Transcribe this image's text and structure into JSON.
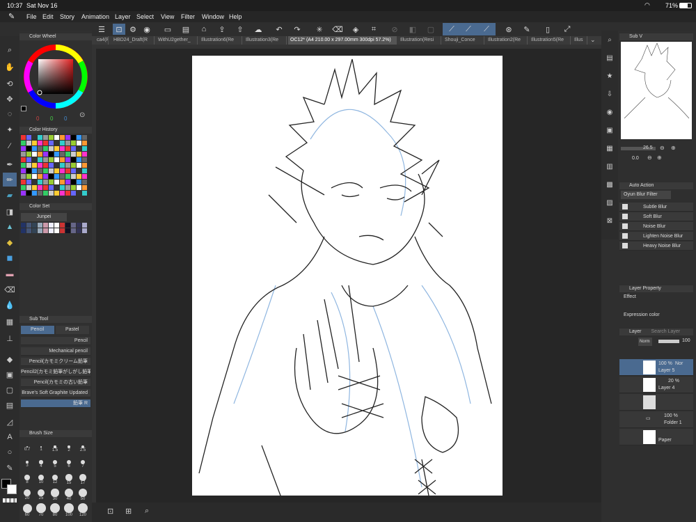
{
  "status": {
    "time": "10:37",
    "date": "Sat Nov 16",
    "battery": "71%"
  },
  "menu": [
    "File",
    "Edit",
    "Story",
    "Animation",
    "Layer",
    "Select",
    "View",
    "Filter",
    "Window",
    "Help"
  ],
  "tabs": [
    "ca4(Re",
    "HBD24_Draft(R",
    "WithU2gether_",
    "Illustration6(Re",
    "Illustration3(Re",
    "OC12* (A4 210.00 x 297.00mm 300dpi 57.2%)",
    "Illustration(Resi",
    "Shouji_Conce",
    "Illustration2(Re",
    "Illustration5(Re",
    "Illus"
  ],
  "left": {
    "color_wheel_title": "Color Wheel",
    "color_values": [
      "0",
      "0",
      "0"
    ],
    "color_history_title": "Color History",
    "color_set_title": "Color Set",
    "color_set_name": "Junpei",
    "sub_tool_title": "Sub Tool",
    "sub_tool_tabs": [
      "Pencil",
      "Pastel"
    ],
    "sub_tools": [
      "Pencil",
      "Mechanical pencil",
      "Pencil(カモミクリーム鉛筆",
      "Pencil2(カモミ鉛筆がしがし鉛筆",
      "Pencil(カモミの古い鉛筆",
      "Brave's Soft Graphite Updated",
      "鉛筆 R"
    ],
    "brush_size_title": "Brush Size",
    "brush_sizes": [
      "0.7",
      "1",
      "1.5",
      "2",
      "2.5",
      "3",
      "4",
      "5",
      "6",
      "7",
      "8",
      "10",
      "12",
      "15",
      "17",
      "20",
      "25",
      "30",
      "40",
      "50",
      "60",
      "70",
      "80",
      "100",
      "120"
    ]
  },
  "right": {
    "navigator_title": "Sub V",
    "zoom": "26.5",
    "rotation": "0.0",
    "auto_action_title": "Auto Action",
    "auto_action_set": "Oyun Blur Filter",
    "auto_actions": [
      "Subtle Blur",
      "Soft Blur",
      "Noise Blur",
      "Lighten Noise Blur",
      "Heavy Noise Blur"
    ],
    "layer_property_title": "Layer Property",
    "effect_label": "Effect",
    "expression_color_label": "Expression color",
    "layer_title": "Layer",
    "layer_search": "Search Layer",
    "blend_mode": "Norm",
    "opacity": "100",
    "layers": [
      {
        "opacity": "100 %",
        "mode": "Nor",
        "name": "Layer 5"
      },
      {
        "opacity": "20 %",
        "mode": "",
        "name": "Layer 4"
      },
      {
        "opacity": "",
        "mode": "",
        "name": ""
      },
      {
        "opacity": "100 %",
        "mode": "",
        "name": "Folder 1"
      },
      {
        "opacity": "",
        "mode": "",
        "name": "Paper"
      }
    ]
  },
  "colors": {
    "accent": "#4a90d9",
    "sketch": "#8fb6e0"
  }
}
